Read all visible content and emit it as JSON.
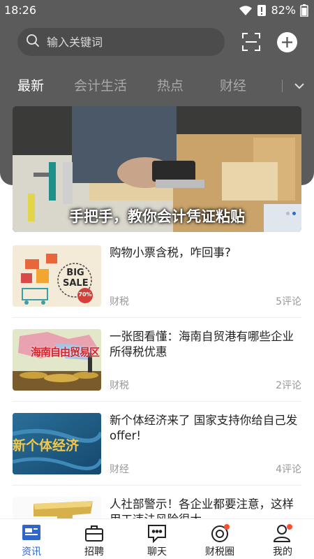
{
  "status_bar": {
    "time": "18:26",
    "battery": "82%"
  },
  "search": {
    "placeholder": "输入关键词"
  },
  "tabs": [
    {
      "label": "最新",
      "active": true
    },
    {
      "label": "会计生活",
      "active": false
    },
    {
      "label": "热点",
      "active": false
    },
    {
      "label": "财经",
      "active": false
    }
  ],
  "banner": {
    "caption": "手把手，教你会计凭证粘贴"
  },
  "news": [
    {
      "title": "购物小票含税，咋回事?",
      "category": "财税",
      "comments": "5评论",
      "thumb_text": "BIG SALE",
      "thumb_badge": "70%"
    },
    {
      "title": "一张图看懂：海南自贸港有哪些企业所得税优惠",
      "category": "财税",
      "comments": "2评论",
      "thumb_text": "海南自由贸易区"
    },
    {
      "title": "新个体经济来了 国家支持你给自己发offer!",
      "category": "财经",
      "comments": "4评论",
      "thumb_text": "新个体经济"
    },
    {
      "title": "人社部警示！各企业都要注意，这样用工违法风险很大",
      "category": "",
      "comments": ""
    }
  ],
  "tabbar": [
    {
      "label": "资讯",
      "icon": "news-icon",
      "active": true
    },
    {
      "label": "招聘",
      "icon": "briefcase-icon",
      "active": false
    },
    {
      "label": "聊天",
      "icon": "chat-icon",
      "active": false
    },
    {
      "label": "财税圈",
      "icon": "circle-icon",
      "active": false
    },
    {
      "label": "我的",
      "icon": "profile-icon",
      "active": false
    }
  ],
  "colors": {
    "accent": "#2f66c8",
    "header_bg": "#5b5b5b",
    "badge": "#ff4d2e"
  }
}
